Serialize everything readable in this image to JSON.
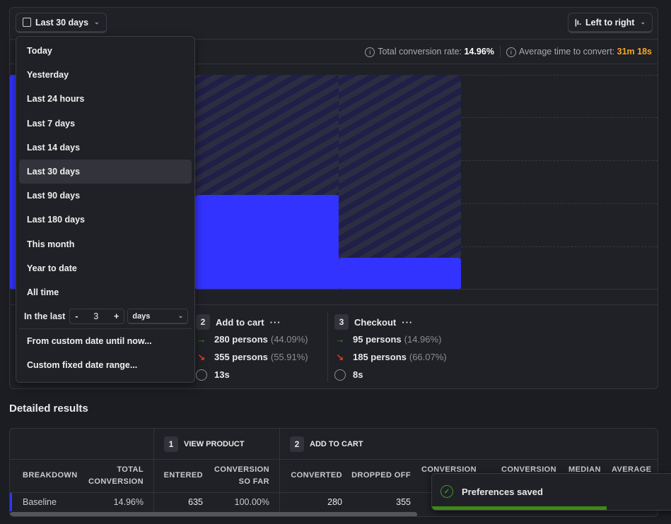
{
  "toolbar": {
    "date_label": "Last 30 days",
    "layout_label": "Left to right"
  },
  "stats": {
    "total_label": "Total conversion rate:",
    "total_value": "14.96%",
    "avg_label": "Average time to convert:",
    "avg_value": "31m 18s",
    "avg_color": "#f5a623"
  },
  "date_menu": {
    "items": [
      "Today",
      "Yesterday",
      "Last 24 hours",
      "Last 7 days",
      "Last 14 days",
      "Last 30 days",
      "Last 90 days",
      "Last 180 days",
      "This month",
      "Year to date",
      "All time"
    ],
    "selected": "Last 30 days",
    "in_the_last_label": "In the last",
    "minus": "-",
    "plus": "+",
    "count": "3",
    "unit": "days",
    "custom_from": "From custom date until now...",
    "custom_range": "Custom fixed date range..."
  },
  "chart_data": {
    "type": "bar",
    "steps": [
      "View product",
      "Add to cart",
      "Checkout"
    ],
    "conversion_percent": [
      100,
      44.09,
      14.96
    ],
    "ylim": [
      0,
      100
    ],
    "bar_color": "#3333ff"
  },
  "steps": [
    {
      "num": "2",
      "name": "Add to cart",
      "more": "···",
      "converted": "280 persons",
      "converted_pct": "(44.09%)",
      "dropped": "355 persons",
      "dropped_pct": "(55.91%)",
      "time": "13s"
    },
    {
      "num": "3",
      "name": "Checkout",
      "more": "···",
      "converted": "95 persons",
      "converted_pct": "(14.96%)",
      "dropped": "185 persons",
      "dropped_pct": "(66.07%)",
      "time": "8s"
    }
  ],
  "detailed": {
    "title": "Detailed results",
    "groups": [
      {
        "num": "1",
        "label": "VIEW PRODUCT"
      },
      {
        "num": "2",
        "label": "ADD TO CART"
      }
    ],
    "columns": [
      "BREAKDOWN",
      "TOTAL CONVERSION",
      "ENTERED",
      "CONVERSION SO FAR",
      "CONVERTED",
      "DROPPED OFF",
      "CONVERSION",
      "CONVERSION",
      "MEDIAN",
      "AVERAGE"
    ],
    "row": {
      "breakdown": "Baseline",
      "total": "14.96%",
      "entered": "635",
      "so_far": "100.00%",
      "converted": "280",
      "dropped": "355"
    }
  },
  "toast": {
    "message": "Preferences saved",
    "progress": 0.72
  }
}
